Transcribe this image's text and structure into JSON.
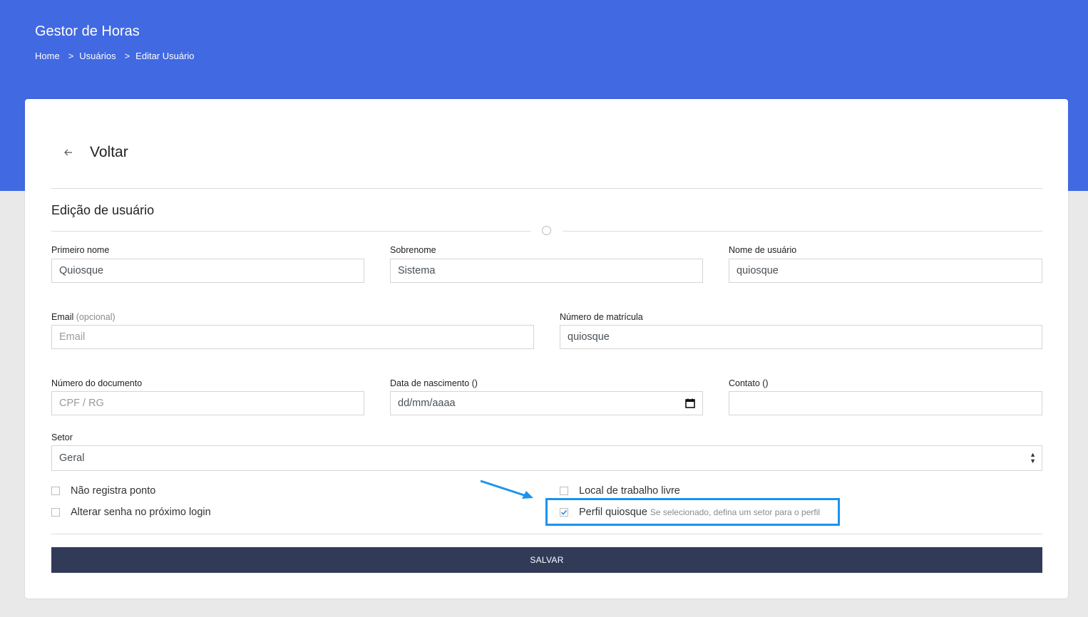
{
  "app": {
    "title": "Gestor de Horas"
  },
  "breadcrumb": {
    "items": [
      "Home",
      "Usuários",
      "Editar Usuário"
    ],
    "separator": ">"
  },
  "back": {
    "label": "Voltar",
    "icon": "arrow-left-icon"
  },
  "form": {
    "title": "Edição de usuário",
    "first_name": {
      "label": "Primeiro nome",
      "value": "Quiosque"
    },
    "last_name": {
      "label": "Sobrenome",
      "value": "Sistema"
    },
    "username": {
      "label": "Nome de usuário",
      "value": "quiosque"
    },
    "email": {
      "label": "Email",
      "label_hint": "(opcional)",
      "value": "",
      "placeholder": "Email"
    },
    "registration": {
      "label": "Número de matrícula",
      "value": "quiosque"
    },
    "document": {
      "label": "Número do documento",
      "value": "",
      "placeholder": "CPF / RG"
    },
    "birth_date": {
      "label": "Data de nascimento ()",
      "placeholder": "dd/mm/aaaa",
      "icon": "calendar-icon"
    },
    "contact": {
      "label": "Contato ()",
      "value": ""
    },
    "sector": {
      "label": "Setor",
      "selected": "Geral"
    },
    "checkboxes": {
      "no_clock": {
        "label": "Não registra ponto",
        "checked": false
      },
      "change_password": {
        "label": "Alterar senha no próximo login",
        "checked": false
      },
      "free_workplace": {
        "label": "Local de trabalho livre",
        "checked": false
      },
      "kiosk_profile": {
        "label": "Perfil quiosque",
        "hint": "Se selecionado, defina um setor para o perfil",
        "checked": true
      }
    },
    "save_label": "SALVAR"
  },
  "colors": {
    "header": "#4169e1",
    "save_button": "#313b58",
    "highlight": "#1a93ef",
    "check": "#1e88e5"
  }
}
